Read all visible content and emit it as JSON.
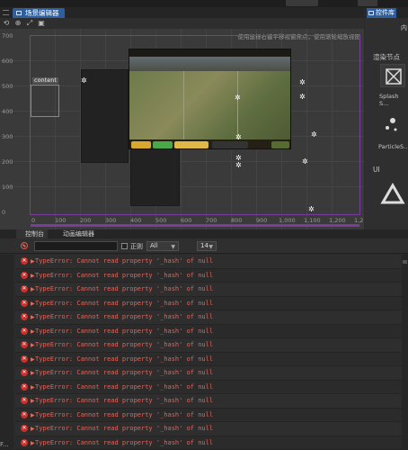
{
  "scene": {
    "tab_label": "场景编辑器",
    "hint": "使用鼠标右键平移视窗焦点，使用滚轮缩放视图",
    "content_label": "content",
    "y_ticks": [
      "700",
      "600",
      "500",
      "400",
      "300",
      "200",
      "100",
      "0"
    ],
    "x_ticks": [
      "0",
      "100",
      "200",
      "300",
      "400",
      "500",
      "600",
      "700",
      "800",
      "900",
      "1,000",
      "1,100",
      "1,200",
      "1,2"
    ],
    "tools": [
      "⟲",
      "⊕",
      "⤢",
      "▣"
    ]
  },
  "library": {
    "tab_label": "控件库",
    "corner_label": "内",
    "section_render": "渲染节点",
    "item_splash": "Splash S...",
    "item_particle": "ParticleS...",
    "section_ui": "UI"
  },
  "console": {
    "tab_console": "控制台",
    "tab_animation": "动画编辑器",
    "filter_value": "",
    "regex_label": "正则",
    "level_select": "All",
    "font_size": "14",
    "logs": [
      "TypeError: Cannot read property '_hash' of null",
      "TypeError: Cannot read property '_hash' of null",
      "TypeError: Cannot read property '_hash' of null",
      "TypeError: Cannot read property '_hash' of null",
      "TypeError: Cannot read property '_hash' of null",
      "TypeError: Cannot read property '_hash' of null",
      "TypeError: Cannot read property '_hash' of null",
      "TypeError: Cannot read property '_hash' of null",
      "TypeError: Cannot read property '_hash' of null",
      "TypeError: Cannot read property '_hash' of null",
      "TypeError: Cannot read property '_hash' of null",
      "TypeError: Cannot read property '_hash' of null",
      "TypeError: Cannot read property '_hash' of null",
      "TypeError: Cannot read property '_hash' of null"
    ],
    "footer": "F..."
  },
  "colors": {
    "accent": "#2d5f9e",
    "error": "#e0655a",
    "frame": "#7a3d9e"
  }
}
